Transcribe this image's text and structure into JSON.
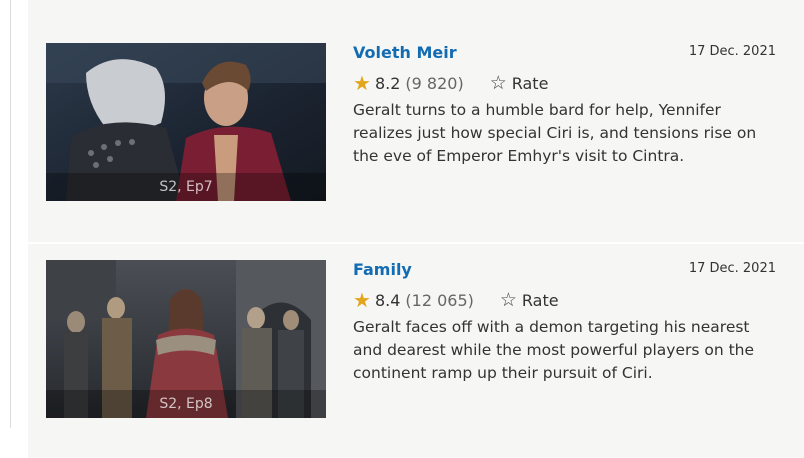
{
  "episodes": [
    {
      "title": "Voleth Meir",
      "date": "17 Dec. 2021",
      "rating": "8.2",
      "votes": "(9 820)",
      "rate_label": "Rate",
      "plot": "Geralt turns to a humble bard for help, Yennifer realizes just how special Ciri is, and tensions rise on the eve of Emperor Emhyr's visit to Cintra.",
      "thumb_label": "S2, Ep7",
      "star_icon": "star-filled-icon",
      "rate_icon": "star-outline-icon"
    },
    {
      "title": "Family",
      "date": "17 Dec. 2021",
      "rating": "8.4",
      "votes": "(12 065)",
      "rate_label": "Rate",
      "plot": "Geralt faces off with a demon targeting his nearest and dearest while the most powerful players on the continent ramp up their pursuit of Ciri.",
      "thumb_label": "S2, Ep8",
      "star_icon": "star-filled-icon",
      "rate_icon": "star-outline-icon"
    }
  ],
  "colors": {
    "title_link": "#136cb2",
    "rating_star": "#e3a51d",
    "card_background": "#f6f6f5"
  }
}
